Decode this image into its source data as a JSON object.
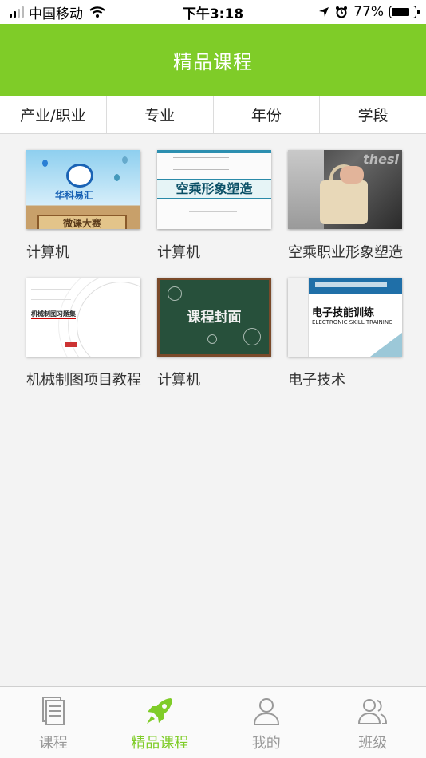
{
  "status_bar": {
    "carrier": "中国移动",
    "time": "下午3:18",
    "battery": "77%",
    "battery_level": 0.77
  },
  "header": {
    "title": "精品课程"
  },
  "filters": [
    {
      "label": "产业/职业"
    },
    {
      "label": "专业"
    },
    {
      "label": "年份"
    },
    {
      "label": "学段"
    }
  ],
  "courses": [
    {
      "title": "计算机",
      "cover": {
        "brand": "华科易汇",
        "board": "微课大赛"
      }
    },
    {
      "title": "计算机",
      "cover": {
        "heading": "空乘形象塑造"
      }
    },
    {
      "title": "空乘职业形象塑造"
    },
    {
      "title": "机械制图项目教程",
      "cover": {
        "heading": "机械制图习题集"
      }
    },
    {
      "title": "计算机",
      "cover": {
        "heading": "课程封面"
      }
    },
    {
      "title": "电子技术",
      "cover": {
        "heading": "电子技能训练",
        "subheading": "ELECTRONIC SKILL TRAINING"
      }
    }
  ],
  "tabs": [
    {
      "label": "课程",
      "icon": "document-icon",
      "active": false
    },
    {
      "label": "精品课程",
      "icon": "rocket-icon",
      "active": true
    },
    {
      "label": "我的",
      "icon": "user-icon",
      "active": false
    },
    {
      "label": "班级",
      "icon": "group-icon",
      "active": false
    }
  ],
  "colors": {
    "accent": "#7fcc28",
    "inactive_tab": "#999999"
  }
}
